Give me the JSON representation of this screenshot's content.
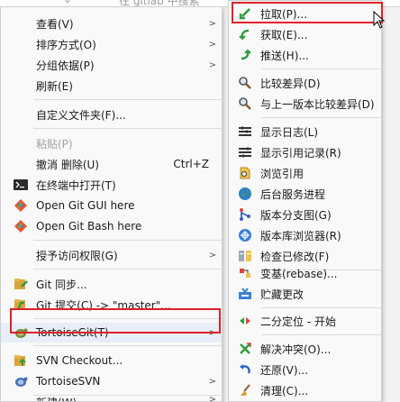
{
  "window": {
    "top_hint": "在 gitlab 中搜索"
  },
  "main_menu": {
    "items": [
      {
        "name": "view",
        "label": "查看(V)",
        "arrow": true
      },
      {
        "name": "sort",
        "label": "排序方式(O)",
        "arrow": true
      },
      {
        "name": "group",
        "label": "分组依据(P)",
        "arrow": true
      },
      {
        "name": "refresh",
        "label": "刷新(E)"
      },
      {
        "name": "customize",
        "label": "自定义文件夹(F)..."
      },
      {
        "name": "paste",
        "label": "粘贴(P)",
        "disabled": true
      },
      {
        "name": "undo",
        "label": "撤消 删除(U)",
        "shortcut": "Ctrl+Z"
      },
      {
        "name": "open-terminal",
        "label": "在终端中打开(T)",
        "icon": "terminal-icon"
      },
      {
        "name": "git-gui",
        "label": "Open Git GUI here",
        "icon": "git-gui-icon"
      },
      {
        "name": "git-bash",
        "label": "Open Git Bash here",
        "icon": "git-bash-icon"
      },
      {
        "name": "grant-access",
        "label": "授予访问权限(G)",
        "arrow": true
      },
      {
        "name": "git-sync",
        "label": "Git 同步...",
        "icon": "git-sync-icon"
      },
      {
        "name": "git-commit",
        "label": "Git 提交(C) -> \"master\"...",
        "icon": "git-commit-icon"
      },
      {
        "name": "tortoisegit",
        "label": "TortoiseGit(T)",
        "icon": "tortoisegit-icon",
        "arrow": true
      },
      {
        "name": "svn-checkout",
        "label": "SVN Checkout...",
        "icon": "svn-checkout-icon"
      },
      {
        "name": "tortoisesvn",
        "label": "TortoiseSVN",
        "icon": "tortoisesvn-icon",
        "arrow": true
      },
      {
        "name": "new",
        "label": "新建(W)",
        "arrow": true
      }
    ]
  },
  "sub_menu": {
    "items": [
      {
        "name": "pull",
        "label": "拉取(P)...",
        "icon": "pull-icon"
      },
      {
        "name": "fetch",
        "label": "获取(E)...",
        "icon": "fetch-icon"
      },
      {
        "name": "push",
        "label": "推送(H)...",
        "icon": "push-icon"
      },
      {
        "name": "diff",
        "label": "比较差异(D)",
        "icon": "diff-icon"
      },
      {
        "name": "diff-previous",
        "label": "与上一版本比较差异(D)",
        "icon": "diff-previous-icon"
      },
      {
        "name": "show-log",
        "label": "显示日志(L)",
        "icon": "log-icon"
      },
      {
        "name": "show-reflog",
        "label": "显示引用记录(R)",
        "icon": "reflog-icon"
      },
      {
        "name": "browse-refs",
        "label": "浏览引用",
        "icon": "browse-refs-icon"
      },
      {
        "name": "daemon",
        "label": "后台服务进程",
        "icon": "daemon-icon"
      },
      {
        "name": "revision-graph",
        "label": "版本分支图(G)",
        "icon": "revision-graph-icon"
      },
      {
        "name": "repo-browser",
        "label": "版本库浏览器(R)",
        "icon": "repo-browser-icon"
      },
      {
        "name": "check-modifications",
        "label": "检查已修改(F)",
        "icon": "check-modifications-icon"
      },
      {
        "name": "rebase",
        "label": "变基(rebase)...",
        "icon": "rebase-icon"
      },
      {
        "name": "stash",
        "label": "贮藏更改",
        "icon": "stash-icon"
      },
      {
        "name": "bisect",
        "label": "二分定位 - 开始",
        "icon": "bisect-icon"
      },
      {
        "name": "resolve",
        "label": "解决冲突(O)...",
        "icon": "resolve-icon"
      },
      {
        "name": "revert",
        "label": "还原(V)...",
        "icon": "revert-icon"
      },
      {
        "name": "cleanup",
        "label": "清理(C)...",
        "icon": "cleanup-icon"
      }
    ]
  },
  "annotations": {
    "highlight_color": "#e0202a",
    "highlighted": [
      "TortoiseGit(T)",
      "拉取(P)..."
    ]
  }
}
